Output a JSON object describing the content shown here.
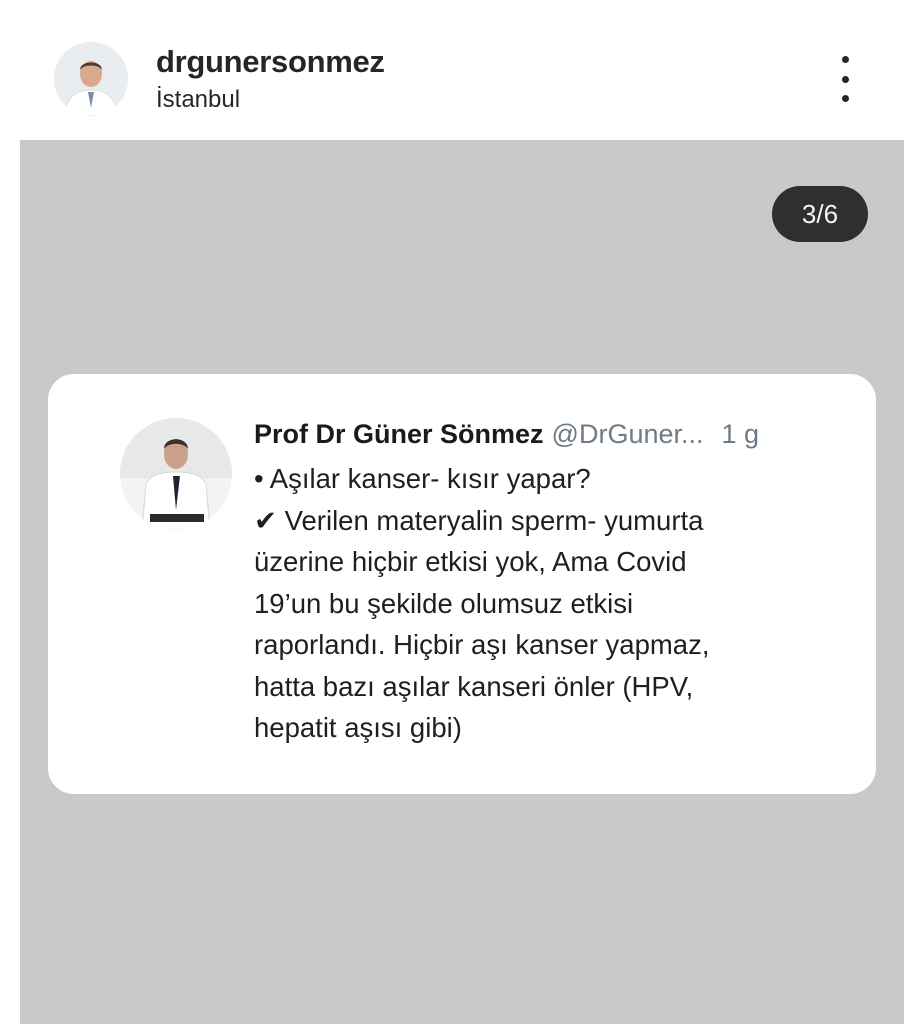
{
  "post": {
    "username": "drgunersonmez",
    "location": "İstanbul"
  },
  "carousel": {
    "counter": "3/6"
  },
  "tweet": {
    "name": "Prof Dr Güner Sönmez",
    "handle": "@DrGuner...",
    "time": "1 g",
    "lines": [
      "• Aşılar kanser- kısır yapar?",
      "✔ Verilen materyalin sperm- yumurta",
      "üzerine hiçbir etkisi yok, Ama Covid",
      "19’un bu şekilde olumsuz etkisi",
      "raporlandı. Hiçbir aşı kanser yapmaz,",
      "hatta bazı aşılar kanseri önler (HPV,",
      "hepatit aşısı gibi)"
    ]
  },
  "icons": {
    "more": "more-vertical-icon",
    "avatar": "profile-photo"
  }
}
